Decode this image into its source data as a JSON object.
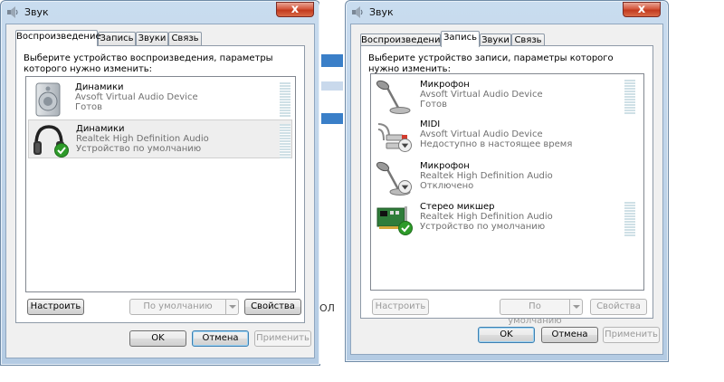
{
  "left_dialog": {
    "title": "Звук",
    "close_label": "x",
    "tabs": [
      {
        "label": "Воспроизведение",
        "active": true
      },
      {
        "label": "Запись",
        "active": false
      },
      {
        "label": "Звуки",
        "active": false
      },
      {
        "label": "Связь",
        "active": false
      }
    ],
    "instruction": "Выберите устройство воспроизведения, параметры которого нужно изменить:",
    "devices": [
      {
        "name": "Динамики",
        "driver": "Avsoft Virtual Audio Device",
        "status": "Готов",
        "icon": "speaker-icon"
      },
      {
        "name": "Динамики",
        "driver": "Realtek High Definition Audio",
        "status": "Устройство по умолчанию",
        "icon": "headphones-icon"
      }
    ],
    "buttons": {
      "configure": "Настроить",
      "set_default": "По умолчанию",
      "properties": "Свойства",
      "ok": "OK",
      "cancel": "Отмена",
      "apply": "Применить"
    }
  },
  "right_dialog": {
    "title": "Звук",
    "close_label": "x",
    "tabs": [
      {
        "label": "Воспроизведение",
        "active": false
      },
      {
        "label": "Запись",
        "active": true
      },
      {
        "label": "Звуки",
        "active": false
      },
      {
        "label": "Связь",
        "active": false
      }
    ],
    "instruction": "Выберите устройство записи, параметры которого нужно изменить:",
    "devices": [
      {
        "name": "Микрофон",
        "driver": "Avsoft Virtual Audio Device",
        "status": "Готов",
        "icon": "microphone-icon"
      },
      {
        "name": "MIDI",
        "driver": "Avsoft Virtual Audio Device",
        "status": "Недоступно в настоящее время",
        "icon": "rca-cable-icon"
      },
      {
        "name": "Микрофон",
        "driver": "Realtek High Definition Audio",
        "status": "Отключено",
        "icon": "microphone-icon"
      },
      {
        "name": "Стерео микшер",
        "driver": "Realtek High Definition Audio",
        "status": "Устройство по умолчанию",
        "icon": "sound-card-icon"
      }
    ],
    "buttons": {
      "configure": "Настроить",
      "set_default": "По умолчанию",
      "properties": "Свойства",
      "ok": "OK",
      "cancel": "Отмена",
      "apply": "Применить"
    }
  },
  "background_text": {
    "fragment": "ОЛ"
  },
  "colors": {
    "title_gradient_top": "#c9dcef",
    "close_red": "#c23a1f",
    "default_check_green": "#2e9b2a",
    "meter": "#cfe0e6"
  }
}
